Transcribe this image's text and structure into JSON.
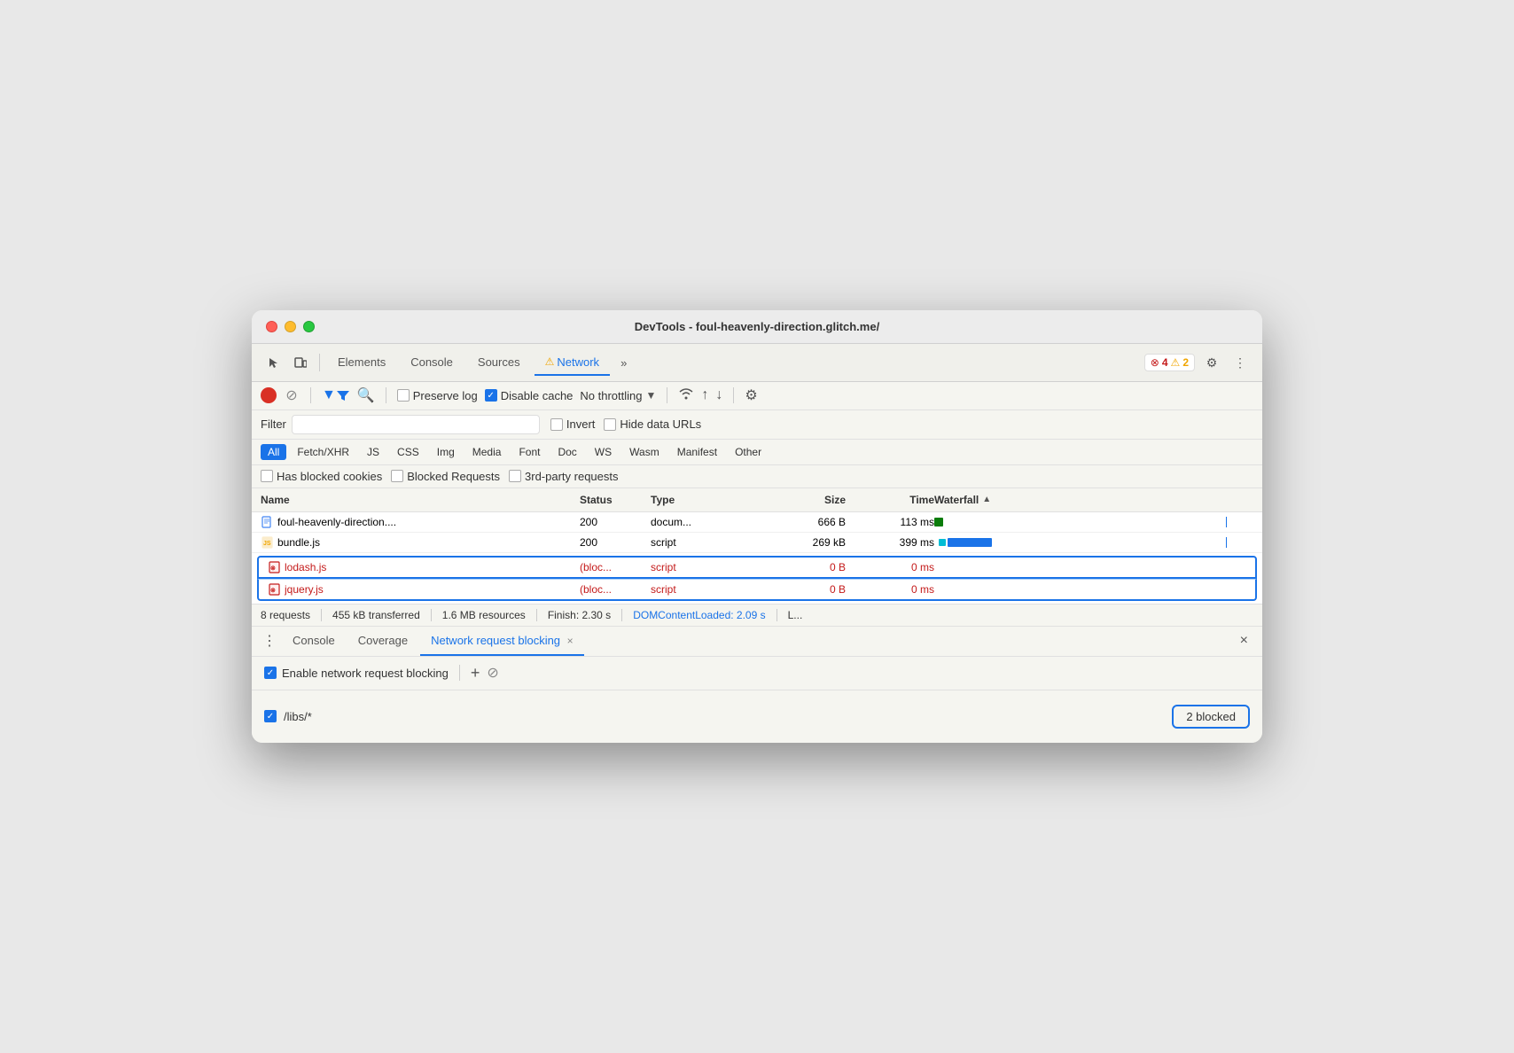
{
  "window": {
    "title": "DevTools - foul-heavenly-direction.glitch.me/"
  },
  "tabs": {
    "items": [
      "Elements",
      "Console",
      "Sources",
      "Network"
    ],
    "active": "Network",
    "more": "»",
    "warning_icon": "⚠"
  },
  "error_badge": {
    "error_icon": "✕",
    "error_count": "4",
    "warn_icon": "⚠",
    "warn_count": "2"
  },
  "network_toolbar": {
    "preserve_log": "Preserve log",
    "disable_cache": "Disable cache",
    "throttle": "No throttling"
  },
  "filter_bar": {
    "filter_label": "Filter",
    "invert_label": "Invert",
    "hide_data_urls_label": "Hide data URLs"
  },
  "type_filters": [
    "All",
    "Fetch/XHR",
    "JS",
    "CSS",
    "Img",
    "Media",
    "Font",
    "Doc",
    "WS",
    "Wasm",
    "Manifest",
    "Other"
  ],
  "active_type": "All",
  "cookie_filters": {
    "blocked_cookies": "Has blocked cookies",
    "blocked_requests": "Blocked Requests",
    "third_party": "3rd-party requests"
  },
  "table_headers": {
    "name": "Name",
    "status": "Status",
    "type": "Type",
    "size": "Size",
    "time": "Time",
    "waterfall": "Waterfall"
  },
  "requests": [
    {
      "icon": "doc",
      "name": "foul-heavenly-direction....",
      "status": "200",
      "type": "docum...",
      "size": "666 B",
      "time": "113 ms",
      "blocked": false,
      "wf_type": "green_only"
    },
    {
      "icon": "js_yellow",
      "name": "bundle.js",
      "status": "200",
      "type": "script",
      "size": "269 kB",
      "time": "399 ms",
      "blocked": false,
      "wf_type": "cyan_blue"
    },
    {
      "icon": "blocked",
      "name": "lodash.js",
      "status": "(bloc...",
      "type": "script",
      "size": "0 B",
      "time": "0 ms",
      "blocked": true,
      "blocked_row": "first",
      "wf_type": "none"
    },
    {
      "icon": "blocked",
      "name": "jquery.js",
      "status": "(bloc...",
      "type": "script",
      "size": "0 B",
      "time": "0 ms",
      "blocked": true,
      "blocked_row": "last",
      "wf_type": "none"
    }
  ],
  "status_bar": {
    "requests": "8 requests",
    "transferred": "455 kB transferred",
    "resources": "1.6 MB resources",
    "finish": "Finish: 2.30 s",
    "dom_content_loaded": "DOMContentLoaded: 2.09 s",
    "load": "L..."
  },
  "bottom_panel": {
    "tabs": [
      "Console",
      "Coverage",
      "Network request blocking"
    ],
    "active_tab": "Network request blocking",
    "close_tab_icon": "×",
    "more_icon": "⋮",
    "close_panel_icon": "×"
  },
  "blocking": {
    "enable_label": "Enable network request blocking",
    "add_icon": "+",
    "clear_icon": "⊘",
    "pattern": "/libs/*",
    "blocked_count": "2 blocked"
  }
}
